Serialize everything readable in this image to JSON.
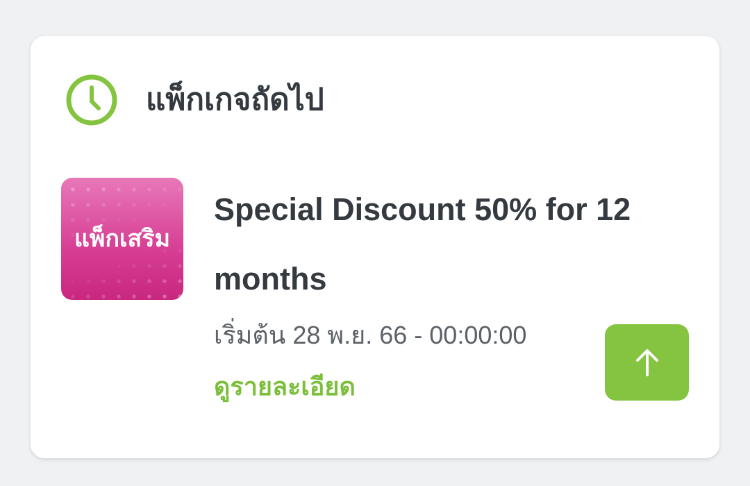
{
  "section": {
    "title": "แพ็กเกจถัดไป",
    "icon": "clock-icon"
  },
  "package": {
    "thumbnail_label": "แพ็กเสริม",
    "title": "Special Discount 50% for 12 months",
    "start_text": "เริ่มต้น 28 พ.ย. 66 - 00:00:00",
    "detail_link": "ดูรายละเอียด"
  },
  "button": {
    "icon": "arrow-up-icon"
  },
  "colors": {
    "accent": "#84c441",
    "link": "#7cbf3a",
    "text": "#343a40",
    "thumbnail": "#d63d93",
    "background": "#f0f1f3"
  }
}
